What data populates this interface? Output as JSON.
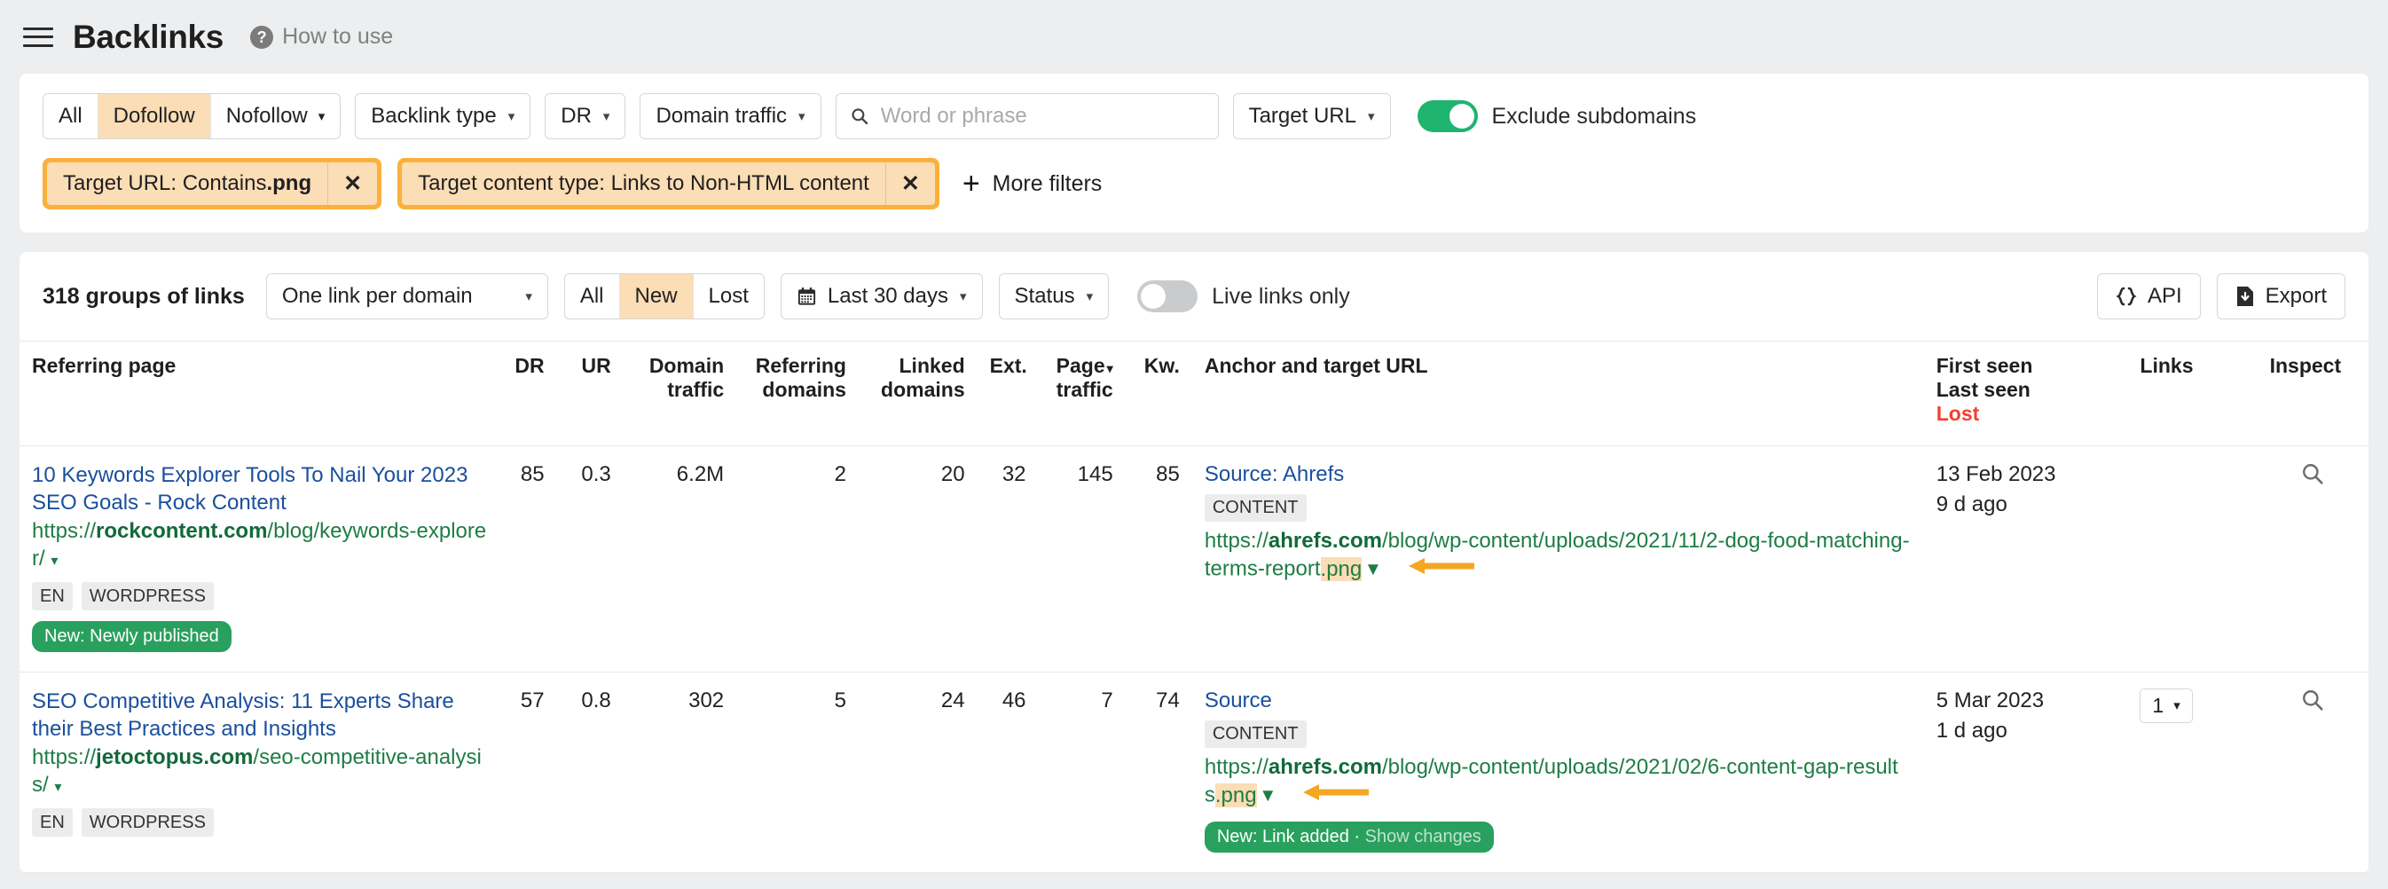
{
  "header": {
    "menu_icon": "hamburger-menu-icon",
    "title": "Backlinks",
    "help_icon": "question-mark-icon",
    "help_label": "How to use"
  },
  "filters": {
    "follow_segment": {
      "options": [
        "All",
        "Dofollow",
        "Nofollow"
      ],
      "active": "Dofollow",
      "caret": "▾"
    },
    "backlink_type": "Backlink type",
    "dr": "DR",
    "domain_traffic": "Domain traffic",
    "search": {
      "placeholder": "Word or phrase",
      "value": "",
      "icon": "search-icon"
    },
    "target_url": "Target URL",
    "exclude_subdomains": {
      "label": "Exclude subdomains",
      "on": true,
      "color": "#1fb470"
    },
    "chips": [
      {
        "prefix": "Target URL: Contains ",
        "strong": ".png",
        "close": "✕"
      },
      {
        "prefix": "Target content type: Links to Non-HTML content",
        "strong": "",
        "close": "✕"
      }
    ],
    "more_filters": {
      "plus": "+",
      "label": "More filters"
    }
  },
  "toolbar": {
    "count": "318 groups of links",
    "grouping": "One link per domain",
    "status_segment": {
      "options": [
        "All",
        "New",
        "Lost"
      ],
      "active": "New"
    },
    "date_range": {
      "label": "Last 30 days",
      "icon": "calendar-icon"
    },
    "status": "Status",
    "live_links_only": {
      "label": "Live links only",
      "on": false
    },
    "api": {
      "label": "API",
      "icon": "code-braces-icon"
    },
    "export": {
      "label": "Export",
      "icon": "download-file-icon"
    }
  },
  "table": {
    "columns": [
      {
        "label": "Referring page",
        "align": "left"
      },
      {
        "label": "DR",
        "align": "right"
      },
      {
        "label": "UR",
        "align": "right"
      },
      {
        "label": "Domain traffic",
        "align": "right"
      },
      {
        "label": "Referring domains",
        "align": "right"
      },
      {
        "label": "Linked domains",
        "align": "right"
      },
      {
        "label": "Ext.",
        "align": "right"
      },
      {
        "label": "Page traffic",
        "align": "right",
        "sorted": true,
        "sort_caret": "▾"
      },
      {
        "label": "Kw.",
        "align": "right"
      },
      {
        "label": "Anchor and target URL",
        "align": "left"
      },
      {
        "label": "First seen",
        "sub": "Last seen",
        "lost": "Lost",
        "align": "left"
      },
      {
        "label": "Links",
        "align": "left"
      },
      {
        "label": "Inspect",
        "align": "left"
      }
    ],
    "col_header_texts": {
      "referring_page": "Referring page",
      "dr": "DR",
      "ur": "UR",
      "domain_traffic_1": "Domain",
      "domain_traffic_2": "traffic",
      "referring_domains_1": "Referring",
      "referring_domains_2": "domains",
      "linked_domains_1": "Linked",
      "linked_domains_2": "domains",
      "ext": "Ext.",
      "page_traffic_1": "Page",
      "page_traffic_2": "traffic",
      "kw": "Kw.",
      "anchor_target": "Anchor and target URL",
      "first_seen": "First seen",
      "last_seen": "Last seen",
      "lost": "Lost",
      "links": "Links",
      "inspect": "Inspect"
    },
    "rows": [
      {
        "title": "10 Keywords Explorer Tools To Nail Your 2023 SEO Goals - Rock Content",
        "url_scheme": "https://",
        "url_domain": "rockcontent.com",
        "url_path": "/blog/keywords-explorer/",
        "url_caret": "▾",
        "tags": [
          "EN",
          "WORDPRESS"
        ],
        "pill": "New: Newly published",
        "pill_muted": "",
        "dr": "85",
        "ur": "0.3",
        "domain_traffic": "6.2M",
        "referring_domains": "2",
        "linked_domains": "20",
        "ext": "32",
        "page_traffic": "145",
        "kw": "85",
        "anchor": "Source: Ahrefs",
        "content_type": "CONTENT",
        "target_scheme": "https://",
        "target_domain": "ahrefs.com",
        "target_path": "/blog/wp-content/uploads/2021/11/2-dog-food-matching-terms-report",
        "target_ext": ".png",
        "target_caret": "▾",
        "first_seen": "13 Feb 2023",
        "last_seen": "9 d ago",
        "links": "",
        "inspect_icon": "magnifier-icon"
      },
      {
        "title": "SEO Competitive Analysis: 11 Experts Share their Best Practices and Insights",
        "url_scheme": "https://",
        "url_domain": "jetoctopus.com",
        "url_path": "/seo-competitive-analysis/",
        "url_caret": "▾",
        "tags": [
          "EN",
          "WORDPRESS"
        ],
        "pill": "New: Link added · ",
        "pill_muted": "Show changes",
        "dr": "57",
        "ur": "0.8",
        "domain_traffic": "302",
        "referring_domains": "5",
        "linked_domains": "24",
        "ext": "46",
        "page_traffic": "7",
        "kw": "74",
        "anchor": "Source",
        "content_type": "CONTENT",
        "target_scheme": "https://",
        "target_domain": "ahrefs.com",
        "target_path": "/blog/wp-content/uploads/2021/02/6-content-gap-results",
        "target_ext": ".png",
        "target_caret": "▾",
        "first_seen": "5 Mar 2023",
        "last_seen": "1 d ago",
        "links": "1",
        "links_caret": "▾",
        "inspect_icon": "magnifier-icon"
      }
    ]
  },
  "colors": {
    "accent_orange": "#fbb03b",
    "chip_fill": "#fbddb6",
    "green_toggle": "#1fb470",
    "link_blue": "#1a4f9c",
    "url_green": "#1e7d45",
    "lost_red": "#f3402f",
    "pill_green": "#2aa05e"
  }
}
